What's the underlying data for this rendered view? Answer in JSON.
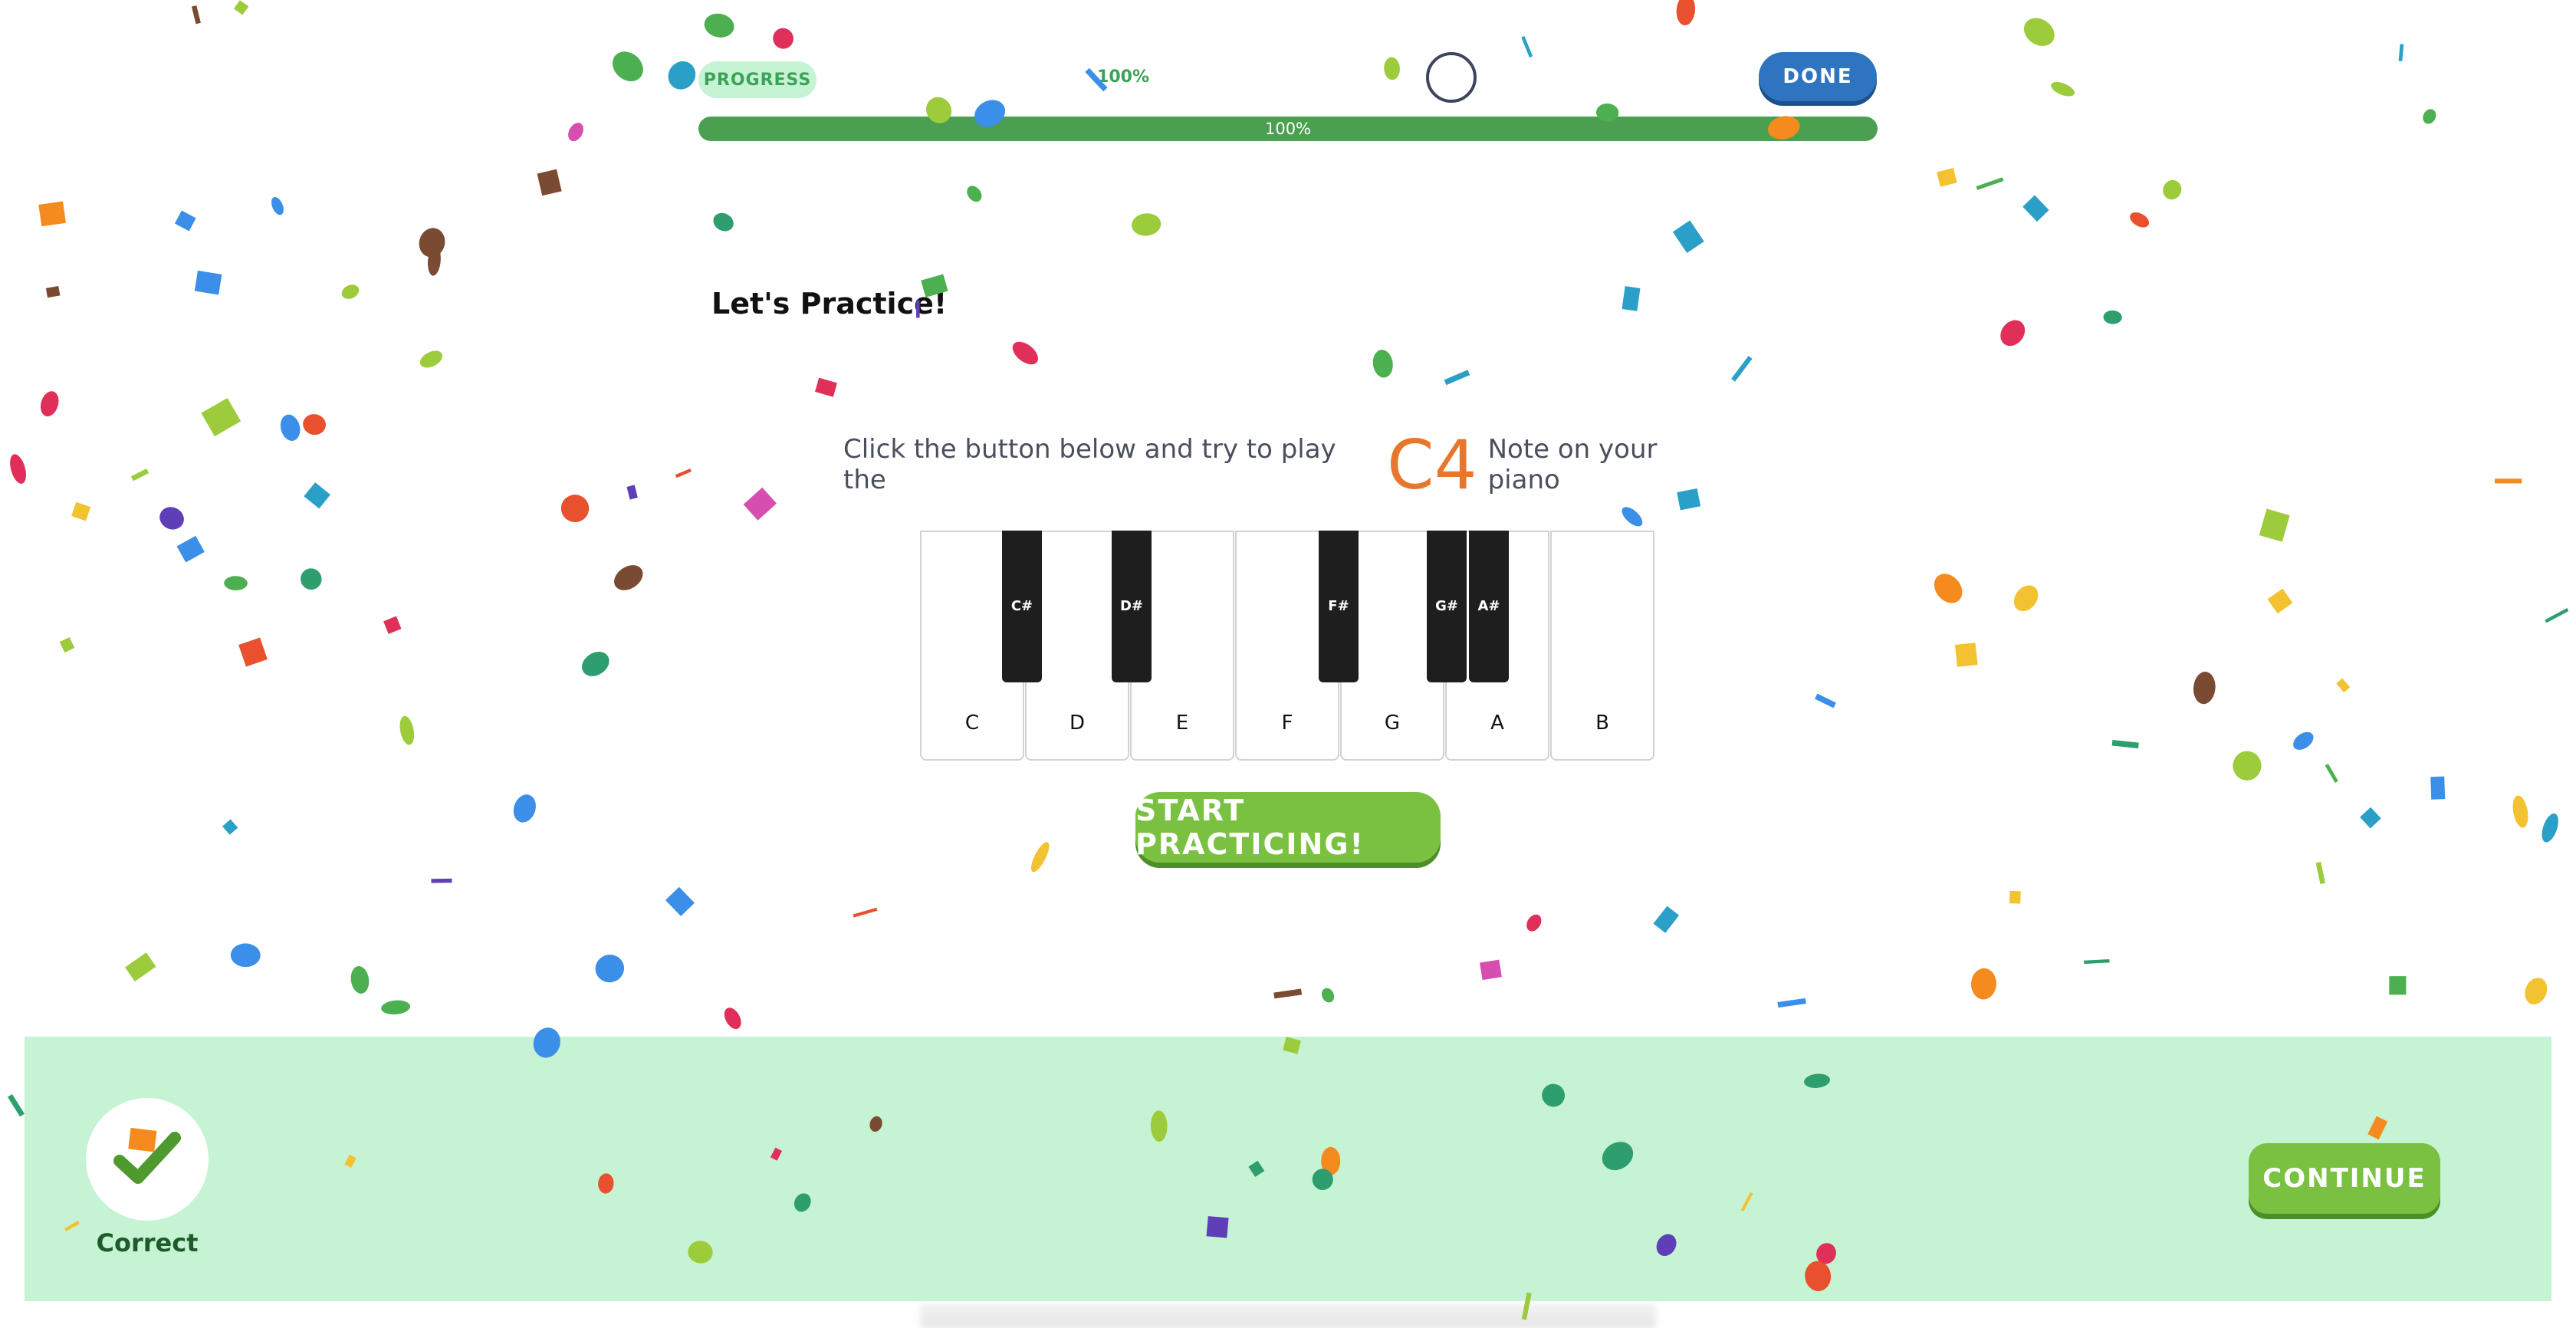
{
  "header": {
    "progress_pill_label": "PROGRESS",
    "progress_percent_text": "100%",
    "progress_value": 1.0,
    "progress_bar_label": "100%",
    "done_label": "DONE"
  },
  "main": {
    "title": "Let's Practice!",
    "instruction_before": "Click the button below and try to play the",
    "note": "C4",
    "instruction_after": "Note on your piano",
    "start_label": "START PRACTICING!"
  },
  "piano": {
    "white_keys": [
      "C",
      "D",
      "E",
      "F",
      "G",
      "A",
      "B"
    ],
    "black_keys": [
      "C#",
      "D#",
      "F#",
      "G#",
      "A#"
    ]
  },
  "feedback": {
    "status": "Correct",
    "continue_label": "CONTINUE"
  },
  "colors": {
    "accent_green": "#7ac142",
    "progress_green": "#4aa050",
    "done_blue": "#2f74c0",
    "note_orange": "#e8772e",
    "feedback_bg": "#c6f3d3"
  }
}
